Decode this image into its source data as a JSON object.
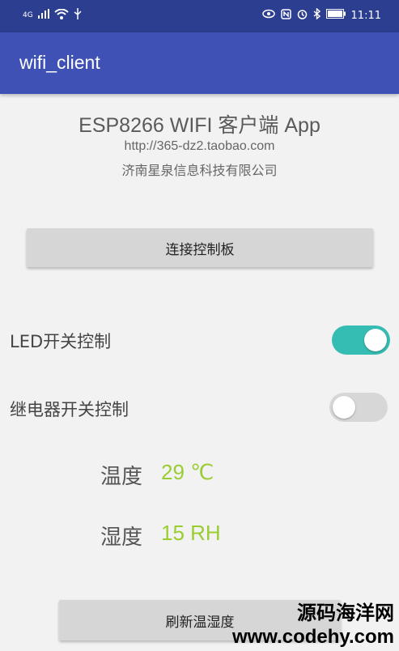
{
  "status_bar": {
    "network": "4G",
    "signal_icon": "signal-bars-icon",
    "wifi_icon": "wifi-icon",
    "usb_icon": "usb-icon",
    "eye_icon": "eye-icon",
    "nfc_icon": "nfc-icon",
    "alarm_icon": "alarm-icon",
    "bluetooth_icon": "bluetooth-icon",
    "battery_icon": "battery-icon",
    "time": "11:11"
  },
  "app_bar": {
    "title": "wifi_client",
    "color": "#3f51b5"
  },
  "header": {
    "title": "ESP8266 WIFI 客户端 App",
    "url": "http://365-dz2.taobao.com",
    "company": "济南星泉信息科技有限公司"
  },
  "connect_button": {
    "label": "连接控制板"
  },
  "led_control": {
    "label": "LED开关控制",
    "state": "on",
    "accent": "#36bdb3"
  },
  "relay_control": {
    "label": "继电器开关控制",
    "state": "off"
  },
  "temperature": {
    "label": "温度",
    "value": "29 ℃"
  },
  "humidity": {
    "label": "湿度",
    "value": "15 RH"
  },
  "refresh_button": {
    "label": "刷新温湿度"
  },
  "watermark": {
    "line1": "源码海洋网",
    "line2": "www.codehy.com"
  },
  "value_color": "#9acd32"
}
